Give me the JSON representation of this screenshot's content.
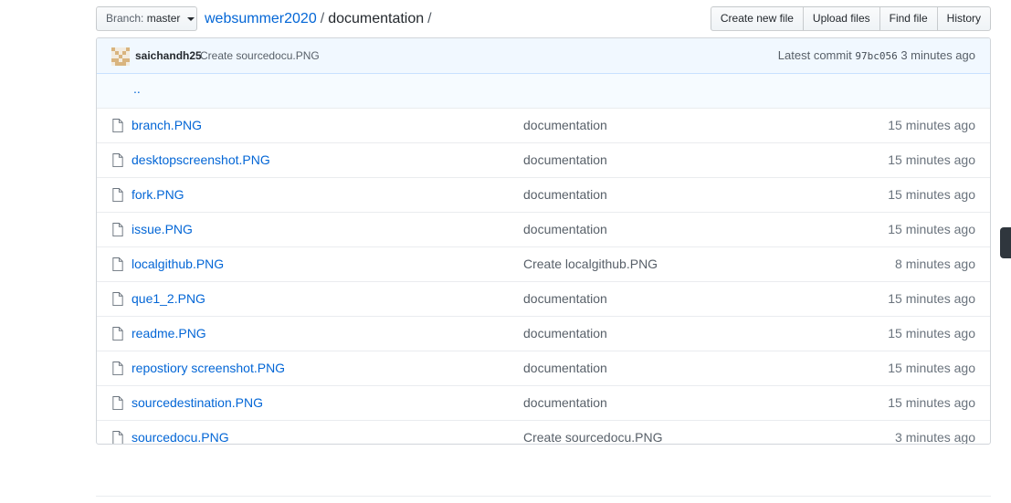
{
  "branch": {
    "prefix": "Branch:",
    "name": "master"
  },
  "breadcrumb": {
    "repo": "websummer2020",
    "separator": "/",
    "folder": "documentation",
    "trailing": "/"
  },
  "actions": {
    "create": "Create new file",
    "upload": "Upload files",
    "find": "Find file",
    "history": "History"
  },
  "commit": {
    "author": "saichandh25",
    "message": "Create sourcedocu.PNG",
    "latest_label": "Latest commit",
    "sha": "97bc056",
    "age": "3 minutes ago"
  },
  "parent_link": "..",
  "files": [
    {
      "name": "branch.PNG",
      "message": "documentation",
      "age": "15 minutes ago"
    },
    {
      "name": "desktopscreenshot.PNG",
      "message": "documentation",
      "age": "15 minutes ago"
    },
    {
      "name": "fork.PNG",
      "message": "documentation",
      "age": "15 minutes ago"
    },
    {
      "name": "issue.PNG",
      "message": "documentation",
      "age": "15 minutes ago"
    },
    {
      "name": "localgithub.PNG",
      "message": "Create localgithub.PNG",
      "age": "8 minutes ago"
    },
    {
      "name": "que1_2.PNG",
      "message": "documentation",
      "age": "15 minutes ago"
    },
    {
      "name": "readme.PNG",
      "message": "documentation",
      "age": "15 minutes ago"
    },
    {
      "name": "repostiory screenshot.PNG",
      "message": "documentation",
      "age": "15 minutes ago"
    },
    {
      "name": "sourcedestination.PNG",
      "message": "documentation",
      "age": "15 minutes ago"
    },
    {
      "name": "sourcedocu.PNG",
      "message": "Create sourcedocu.PNG",
      "age": "3 minutes ago"
    }
  ],
  "colors": {
    "link": "#0366d6",
    "commit_bar": "#f1f8ff",
    "muted": "#586069"
  },
  "icons": {
    "file": "file-icon",
    "avatar": "identicon-avatar",
    "caret": "caret-down-icon"
  }
}
